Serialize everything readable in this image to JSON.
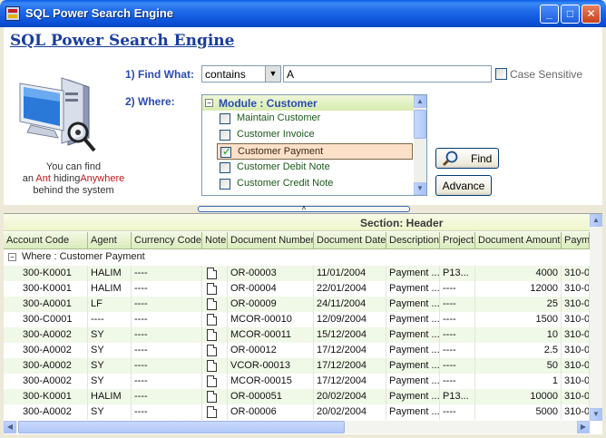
{
  "window": {
    "title": "SQL Power Search Engine",
    "min": "_",
    "max": "□",
    "close": "✕"
  },
  "app_title": "SQL Power Search Engine",
  "find": {
    "label": "1) Find What:",
    "operator": "contains",
    "value": "A",
    "case_sensitive_label": "Case Sensitive",
    "case_sensitive": false
  },
  "where": {
    "label": "2) Where:",
    "module_header": "Module : Customer",
    "items": [
      {
        "label": "Maintain Customer",
        "checked": false
      },
      {
        "label": "Customer Invoice",
        "checked": false
      },
      {
        "label": "Customer Payment",
        "checked": true
      },
      {
        "label": "Customer Debit Note",
        "checked": false
      },
      {
        "label": "Customer Credit Note",
        "checked": false
      }
    ]
  },
  "buttons": {
    "find": "Find",
    "advance": "Advance"
  },
  "promo": {
    "line1": "You can find",
    "line2_pre": "an ",
    "ant": "Ant",
    "line2_mid": " hiding",
    "anywhere": "Anywhere",
    "line3": "behind the system"
  },
  "splitter_glyph": "˄",
  "grid": {
    "section": "Section: Header",
    "columns": [
      "Account Code",
      "Agent",
      "Currency Code",
      "Note",
      "Document Number",
      "Document Date",
      "Description",
      "Project",
      "Document Amount",
      "Paym"
    ],
    "group": "Where : Customer Payment",
    "rows": [
      [
        "300-K0001",
        "HALIM",
        "----",
        "",
        "OR-00003",
        "11/01/2004",
        "Payment ...",
        "P13...",
        "4000",
        "310-0"
      ],
      [
        "300-K0001",
        "HALIM",
        "----",
        "",
        "OR-00004",
        "22/01/2004",
        "Payment ...",
        "----",
        "12000",
        "310-0"
      ],
      [
        "300-A0001",
        "LF",
        "----",
        "",
        "OR-00009",
        "24/11/2004",
        "Payment ...",
        "----",
        "25",
        "310-0"
      ],
      [
        "300-C0001",
        "----",
        "----",
        "",
        "MCOR-00010",
        "12/09/2004",
        "Payment ...",
        "----",
        "1500",
        "310-0"
      ],
      [
        "300-A0002",
        "SY",
        "----",
        "",
        "MCOR-00011",
        "15/12/2004",
        "Payment ...",
        "----",
        "10",
        "310-0"
      ],
      [
        "300-A0002",
        "SY",
        "----",
        "",
        "OR-00012",
        "17/12/2004",
        "Payment ...",
        "----",
        "2.5",
        "310-0"
      ],
      [
        "300-A0002",
        "SY",
        "----",
        "",
        "VCOR-00013",
        "17/12/2004",
        "Payment ...",
        "----",
        "50",
        "310-0"
      ],
      [
        "300-A0002",
        "SY",
        "----",
        "",
        "MCOR-00015",
        "17/12/2004",
        "Payment ...",
        "----",
        "1",
        "310-0"
      ],
      [
        "300-K0001",
        "HALIM",
        "----",
        "",
        "OR-000051",
        "20/02/2004",
        "Payment ...",
        "P13...",
        "10000",
        "310-0"
      ],
      [
        "300-A0002",
        "SY",
        "----",
        "",
        "OR-00006",
        "20/02/2004",
        "Payment ...",
        "----",
        "5000",
        "310-0"
      ]
    ]
  },
  "colors": {
    "title_blue": "#1a3e9e",
    "selected_item": "#fde0c8",
    "header_green": "#d9ecbc"
  }
}
